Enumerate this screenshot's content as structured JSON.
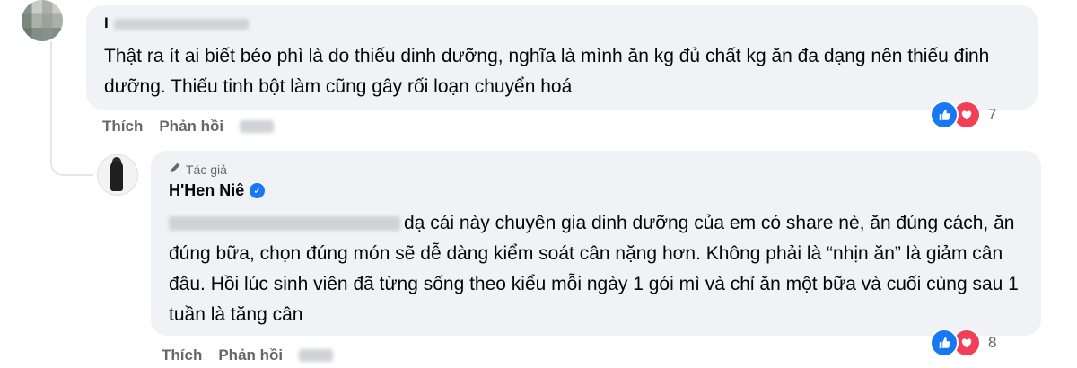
{
  "top_comment": {
    "text": "Thật ra ít ai biết béo phì là do thiếu dinh dưỡng, nghĩa là mình ăn kg đủ chất kg ăn đa dạng nên thiếu đinh dưỡng. Thiếu tinh bột làm cũng gây rối loạn chuyển hoá",
    "author_initial": "I",
    "actions": {
      "like": "Thích",
      "reply": "Phản hồi"
    },
    "reaction_count": "7"
  },
  "reply": {
    "badge": "Tác giả",
    "author": "H'Hen Niê",
    "text": "dạ cái này chuyên gia dinh dưỡng của em có share nè, ăn đúng cách, ăn đúng bữa, chọn đúng món sẽ dễ dàng kiểm soát cân nặng hơn. Không phải là “nhịn ăn” là giảm cân đâu. Hồi lúc sinh viên đã từng sống theo kiểu mỗi ngày 1 gói mì và chỉ ăn một bữa và cuối cùng sau 1 tuần là tăng cân",
    "actions": {
      "like": "Thích",
      "reply": "Phản hồi"
    },
    "reaction_count": "8"
  },
  "icons": {
    "like": "thumbs-up-icon",
    "love": "heart-icon",
    "pencil": "pencil-icon",
    "verified": "verified-check-icon"
  },
  "colors": {
    "bubble": "#f0f2f5",
    "secondary_text": "#65676b",
    "like_blue": "#1877f2",
    "love_red": "#f33e58"
  }
}
